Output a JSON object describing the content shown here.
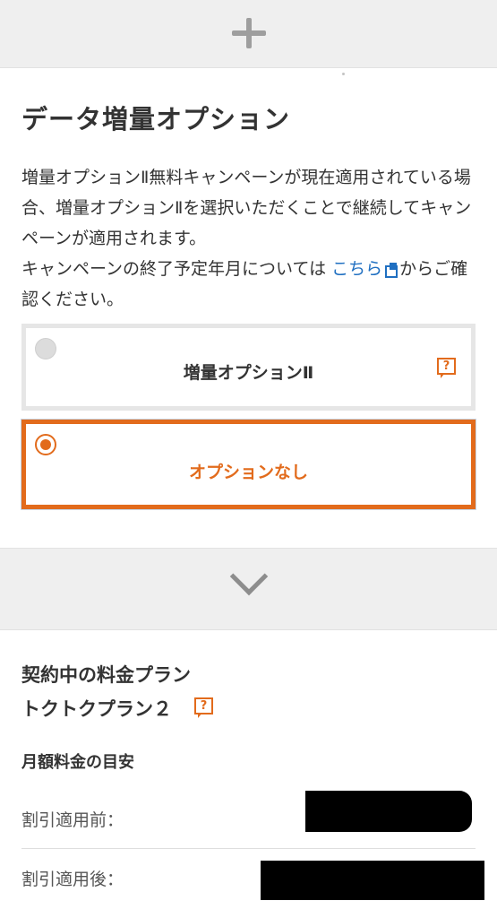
{
  "section": {
    "title": "データ増量オプション",
    "description": {
      "line1": "増量オプションⅡ無料キャンペーンが現在適用されている場合、増量オプションⅡを選択いただくことで継続してキャンペーンが適用されます。",
      "line2_prefix": "キャンペーンの終了予定年月については",
      "link_text": "こちら",
      "line2_suffix": "からご確認ください。"
    }
  },
  "options": [
    {
      "label": "増量オプションⅡ",
      "selected": false,
      "help_icon": "question-bubble-icon"
    },
    {
      "label": "オプションなし",
      "selected": true
    }
  ],
  "plan": {
    "heading": "契約中の料金プラン",
    "name": "トクトクプラン２",
    "help_icon": "question-bubble-icon",
    "fee_heading": "月額料金の目安",
    "before_discount_label": "割引適用前：",
    "after_discount_label": "割引適用後："
  },
  "icons": {
    "top_band": "plus-icon",
    "mid_band": "chevron-down-icon",
    "link": "external-link-icon",
    "help_glyph": "?"
  },
  "colors": {
    "accent": "#e26b1c",
    "link": "#1f6fc1",
    "band_bg": "#efefef",
    "text": "#333333"
  }
}
